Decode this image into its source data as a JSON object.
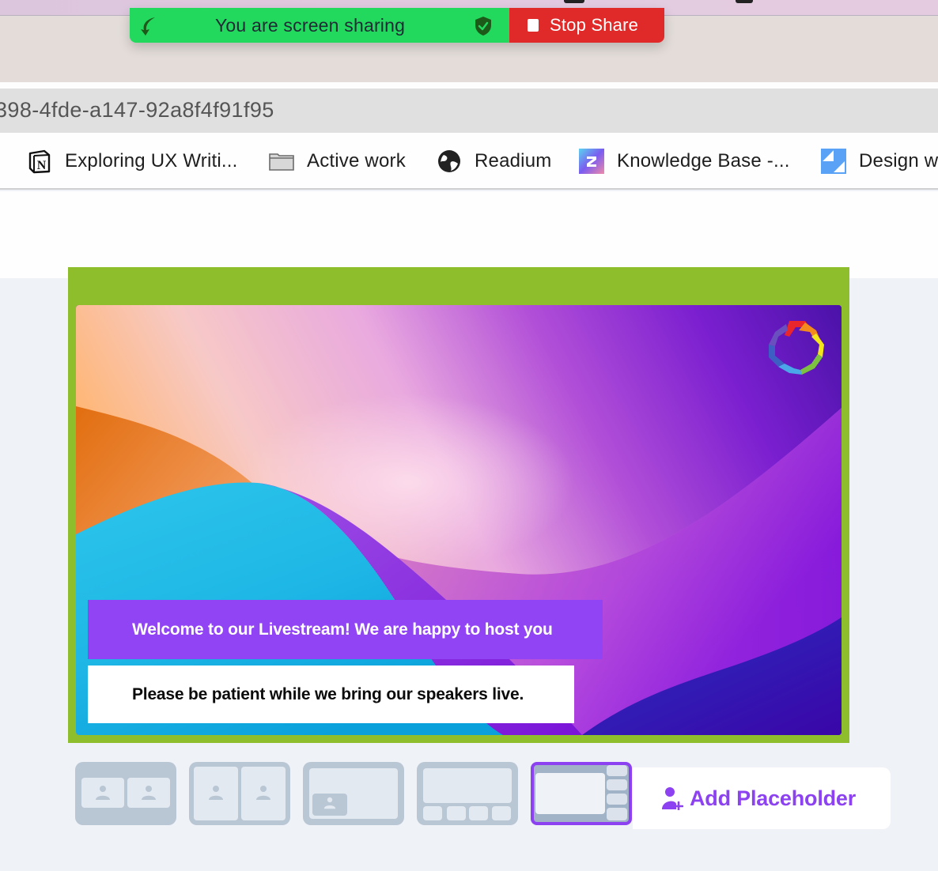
{
  "screen_share": {
    "status_text": "You are screen sharing",
    "stop_label": "Stop Share",
    "colors": {
      "bar": "#22d95e",
      "stop": "#e02a2a"
    }
  },
  "browser": {
    "url_fragment": "398-4fde-a147-92a8f4f91f95",
    "bookmarks": [
      {
        "label": "Exploring UX Writi...",
        "icon": "notion-icon"
      },
      {
        "label": "Active work",
        "icon": "folder-icon"
      },
      {
        "label": "Readium",
        "icon": "globe-icon"
      },
      {
        "label": "Knowledge Base -...",
        "icon": "z-app-icon"
      },
      {
        "label": "Design w",
        "icon": "zendesk-icon"
      }
    ]
  },
  "stage": {
    "frame_color": "#8fbe2c",
    "banners": [
      {
        "text": "Welcome to our Livestream! We are happy to host you",
        "style": "primary",
        "background": "#9044f3"
      },
      {
        "text": "Please be patient while we bring our speakers live.",
        "style": "secondary",
        "background": "#ffffff"
      }
    ],
    "logo": "rainbow-heptagon-logo"
  },
  "layouts": {
    "options": [
      {
        "name": "two-side-by-side",
        "selected": false
      },
      {
        "name": "two-split",
        "selected": false
      },
      {
        "name": "picture-in-picture",
        "selected": false
      },
      {
        "name": "main-with-bottom-row",
        "selected": false
      },
      {
        "name": "main-with-side-column",
        "selected": true
      }
    ],
    "accent": "#8c42f0"
  },
  "add_placeholder": {
    "label": "Add Placeholder",
    "icon": "add-person-icon"
  }
}
